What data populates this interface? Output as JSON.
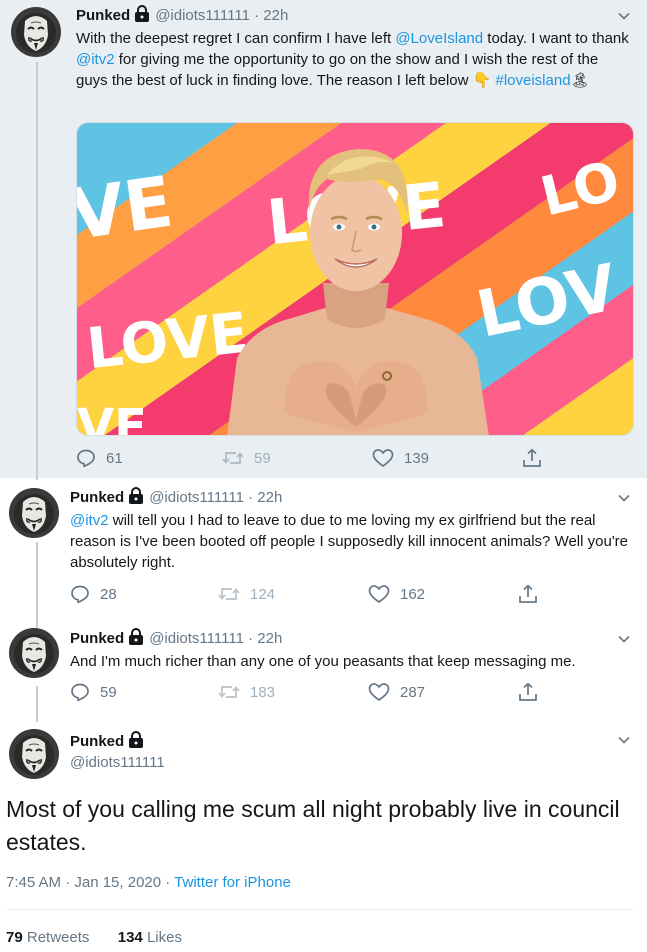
{
  "user": {
    "name": "Punked",
    "handle": "@idiots111111"
  },
  "tweets": [
    {
      "time": "22h",
      "text_parts": [
        "With the deepest regret I can confirm I have left ",
        "@LoveIsland",
        " today. I want to thank ",
        "@itv2",
        " for giving me the opportunity to go on the show and I wish the rest of the guys the best of luck in finding love. The reason I left below ",
        "👇",
        " ",
        "#loveisland",
        "🏝"
      ],
      "replies": "61",
      "retweets": "59",
      "likes": "139",
      "image_words": [
        "VE",
        "LOVE",
        "LOVE",
        "LOV",
        "LO",
        "VE"
      ]
    },
    {
      "time": "22h",
      "text_parts": [
        "@itv2",
        " will tell you I had to leave to due to me loving my ex girlfriend but the real reason is I've been booted off people I supposedly kill innocent animals? Well you're absolutely right."
      ],
      "replies": "28",
      "retweets": "124",
      "likes": "162"
    },
    {
      "time": "22h",
      "text": "And I'm much richer than any one of you peasants that keep messaging me.",
      "replies": "59",
      "retweets": "183",
      "likes": "287"
    }
  ],
  "main_tweet": {
    "text": "Most of you calling me scum all night probably live in council estates.",
    "time_date": "7:45 AM · Jan 15, 2020",
    "separator": " · ",
    "source": "Twitter for iPhone",
    "retweets_count": "79",
    "retweets_label": "Retweets",
    "likes_count": "134",
    "likes_label": "Likes"
  },
  "colors": {
    "link": "#1b95e0",
    "secondary": "#657786",
    "thread_bg": "#e9eef2"
  },
  "icons": [
    "anonymous-mask-avatar",
    "lock-icon",
    "chevron-down-icon",
    "reply-icon",
    "retweet-icon",
    "like-icon",
    "share-icon"
  ]
}
